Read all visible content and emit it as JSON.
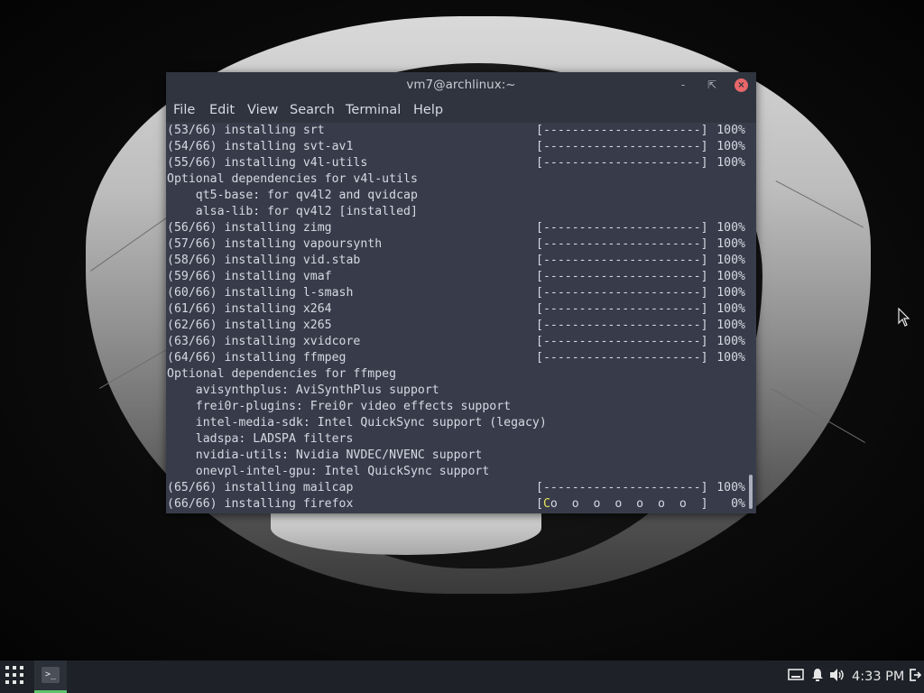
{
  "window": {
    "title": "vm7@archlinux:~",
    "controls": {
      "minimize": "-",
      "maximize": "⇱",
      "close": "×"
    }
  },
  "menubar": {
    "items": [
      "File",
      "Edit",
      "View",
      "Search",
      "Terminal",
      "Help"
    ]
  },
  "terminal": {
    "lines": [
      {
        "text": "(53/66) installing srt",
        "bar": "[----------------------]",
        "pct": "100%"
      },
      {
        "text": "(54/66) installing svt-av1",
        "bar": "[----------------------]",
        "pct": "100%"
      },
      {
        "text": "(55/66) installing v4l-utils",
        "bar": "[----------------------]",
        "pct": "100%"
      },
      {
        "text": "Optional dependencies for v4l-utils",
        "bar": "",
        "pct": ""
      },
      {
        "text": "    qt5-base: for qv4l2 and qvidcap",
        "bar": "",
        "pct": ""
      },
      {
        "text": "    alsa-lib: for qv4l2 [installed]",
        "bar": "",
        "pct": ""
      },
      {
        "text": "(56/66) installing zimg",
        "bar": "[----------------------]",
        "pct": "100%"
      },
      {
        "text": "(57/66) installing vapoursynth",
        "bar": "[----------------------]",
        "pct": "100%"
      },
      {
        "text": "(58/66) installing vid.stab",
        "bar": "[----------------------]",
        "pct": "100%"
      },
      {
        "text": "(59/66) installing vmaf",
        "bar": "[----------------------]",
        "pct": "100%"
      },
      {
        "text": "(60/66) installing l-smash",
        "bar": "[----------------------]",
        "pct": "100%"
      },
      {
        "text": "(61/66) installing x264",
        "bar": "[----------------------]",
        "pct": "100%"
      },
      {
        "text": "(62/66) installing x265",
        "bar": "[----------------------]",
        "pct": "100%"
      },
      {
        "text": "(63/66) installing xvidcore",
        "bar": "[----------------------]",
        "pct": "100%"
      },
      {
        "text": "(64/66) installing ffmpeg",
        "bar": "[----------------------]",
        "pct": "100%"
      },
      {
        "text": "Optional dependencies for ffmpeg",
        "bar": "",
        "pct": ""
      },
      {
        "text": "    avisynthplus: AviSynthPlus support",
        "bar": "",
        "pct": ""
      },
      {
        "text": "    frei0r-plugins: Frei0r video effects support",
        "bar": "",
        "pct": ""
      },
      {
        "text": "    intel-media-sdk: Intel QuickSync support (legacy)",
        "bar": "",
        "pct": ""
      },
      {
        "text": "    ladspa: LADSPA filters",
        "bar": "",
        "pct": ""
      },
      {
        "text": "    nvidia-utils: Nvidia NVDEC/NVENC support",
        "bar": "",
        "pct": ""
      },
      {
        "text": "    onevpl-intel-gpu: Intel QuickSync support",
        "bar": "",
        "pct": ""
      },
      {
        "text": "(65/66) installing mailcap",
        "bar": "[----------------------]",
        "pct": "100%"
      },
      {
        "text": "(66/66) installing firefox",
        "bar": "[",
        "pacman": "C",
        "bar_rest": "o  o  o  o  o  o  o  ]",
        "pct": "0%"
      }
    ]
  },
  "taskbar": {
    "apps_icon": "apps-grid-icon",
    "terminal_task_icon": ">_",
    "tray": {
      "network_icon": "network-icon",
      "notifications_icon": "bell-icon",
      "volume_icon": "volume-icon",
      "logout_icon": "logout-icon"
    },
    "clock": "4:33 PM"
  },
  "colors": {
    "terminal_bg": "#383c4a",
    "titlebar_bg": "#2f343f",
    "close_button": "#e8676b",
    "pacman": "#e8e25a",
    "taskbar_bg": "#1e2127",
    "active_indicator": "#5ec46b"
  }
}
